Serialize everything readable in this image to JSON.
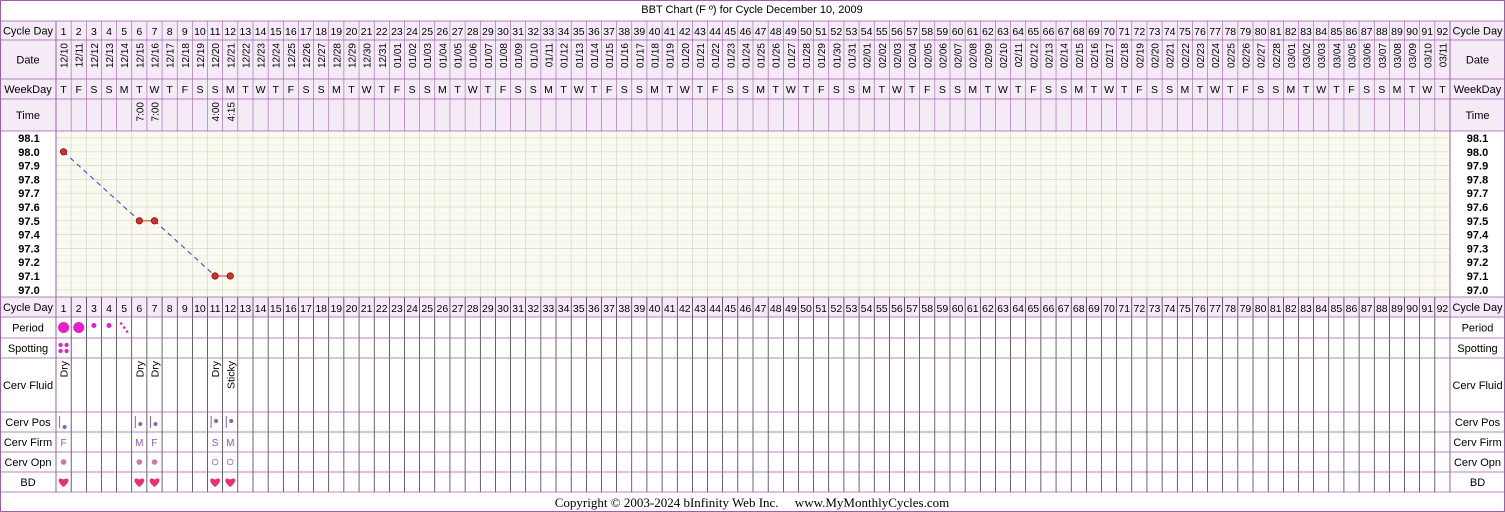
{
  "title": "BBT Chart (F º) for Cycle December 10, 2009",
  "copyright": "Copyright © 2003-2024 bInfinity Web Inc.     www.MyMonthlyCycles.com",
  "labels": {
    "cycle_day": "Cycle Day",
    "date": "Date",
    "weekday": "WeekDay",
    "time": "Time",
    "period": "Period",
    "spotting": "Spotting",
    "cerv_fluid": "Cerv Fluid",
    "cerv_pos": "Cerv Pos",
    "cerv_firm": "Cerv Firm",
    "cerv_opn": "Cerv Opn",
    "bd": "BD"
  },
  "chart_data": {
    "type": "line",
    "title": "BBT Chart (F º) for Cycle December 10, 2009",
    "ylim": [
      97.0,
      98.1
    ],
    "y_ticks": [
      "98.1",
      "98.0",
      "97.9",
      "97.8",
      "97.7",
      "97.6",
      "97.5",
      "97.4",
      "97.3",
      "97.2",
      "97.1",
      "97.0"
    ],
    "grid": true,
    "cycle_days": [
      1,
      2,
      3,
      4,
      5,
      6,
      7,
      8,
      9,
      10,
      11,
      12,
      13,
      14,
      15,
      16,
      17,
      18,
      19,
      20,
      21,
      22,
      23,
      24,
      25,
      26,
      27,
      28,
      29,
      30,
      31,
      32,
      33,
      34,
      35,
      36,
      37,
      38,
      39,
      40,
      41,
      42,
      43,
      44,
      45,
      46,
      47,
      48,
      49,
      50,
      51,
      52,
      53,
      54,
      55,
      56,
      57,
      58,
      59,
      60,
      61,
      62,
      63,
      64,
      65,
      66,
      67,
      68,
      69,
      70,
      71,
      72,
      73,
      74,
      75,
      76,
      77,
      78,
      79,
      80,
      81,
      82,
      83,
      84,
      85,
      86,
      87,
      88,
      89,
      90,
      91,
      92
    ],
    "dates": [
      "12/10",
      "12/11",
      "12/12",
      "12/13",
      "12/14",
      "12/15",
      "12/16",
      "12/17",
      "12/18",
      "12/19",
      "12/20",
      "12/21",
      "12/22",
      "12/23",
      "12/24",
      "12/25",
      "12/26",
      "12/27",
      "12/28",
      "12/29",
      "12/30",
      "12/31",
      "01/01",
      "01/02",
      "01/03",
      "01/04",
      "01/05",
      "01/06",
      "01/07",
      "01/08",
      "01/09",
      "01/10",
      "01/11",
      "01/12",
      "01/13",
      "01/14",
      "01/15",
      "01/16",
      "01/17",
      "01/18",
      "01/19",
      "01/20",
      "01/21",
      "01/22",
      "01/23",
      "01/24",
      "01/25",
      "01/26",
      "01/27",
      "01/28",
      "01/29",
      "01/30",
      "01/31",
      "02/01",
      "02/02",
      "02/03",
      "02/04",
      "02/05",
      "02/06",
      "02/07",
      "02/08",
      "02/09",
      "02/10",
      "02/11",
      "02/12",
      "02/13",
      "02/14",
      "02/15",
      "02/16",
      "02/17",
      "02/18",
      "02/19",
      "02/20",
      "02/21",
      "02/22",
      "02/23",
      "02/24",
      "02/25",
      "02/26",
      "02/27",
      "02/28",
      "03/01",
      "03/02",
      "03/03",
      "03/04",
      "03/05",
      "03/06",
      "03/07",
      "03/08",
      "03/09",
      "03/10",
      "03/11"
    ],
    "weekdays": [
      "T",
      "F",
      "S",
      "S",
      "M",
      "T",
      "W",
      "T",
      "F",
      "S",
      "S",
      "M",
      "T",
      "W",
      "T",
      "F",
      "S",
      "S",
      "M",
      "T",
      "W",
      "T",
      "F",
      "S",
      "S",
      "M",
      "T",
      "W",
      "T",
      "F",
      "S",
      "S",
      "M",
      "T",
      "W",
      "T",
      "F",
      "S",
      "S",
      "M",
      "T",
      "W",
      "T",
      "F",
      "S",
      "S",
      "M",
      "T",
      "W",
      "T",
      "F",
      "S",
      "S",
      "M",
      "T",
      "W",
      "T",
      "F",
      "S",
      "S",
      "M",
      "T",
      "W",
      "T",
      "F",
      "S",
      "S",
      "M",
      "T",
      "W",
      "T",
      "F",
      "S",
      "S",
      "M",
      "T",
      "W",
      "T",
      "F",
      "S",
      "S",
      "M",
      "T",
      "W",
      "T",
      "F",
      "S",
      "S",
      "M",
      "T",
      "W",
      "T"
    ],
    "times": [
      {
        "day": 6,
        "text": "7:00"
      },
      {
        "day": 7,
        "text": "7:00"
      },
      {
        "day": 11,
        "text": "4:00"
      },
      {
        "day": 12,
        "text": "4:15"
      }
    ],
    "temps": [
      {
        "day": 1,
        "temp": 98.0
      },
      {
        "day": 6,
        "temp": 97.5
      },
      {
        "day": 7,
        "temp": 97.5
      },
      {
        "day": 11,
        "temp": 97.1
      },
      {
        "day": 12,
        "temp": 97.1
      }
    ],
    "connections": [
      {
        "from": 1,
        "to": 6,
        "style": "dashed"
      },
      {
        "from": 6,
        "to": 7,
        "style": "solid"
      },
      {
        "from": 7,
        "to": 11,
        "style": "dashed"
      },
      {
        "from": 11,
        "to": 12,
        "style": "solid"
      }
    ],
    "period": [
      {
        "day": 1,
        "level": "heavy"
      },
      {
        "day": 2,
        "level": "heavy"
      },
      {
        "day": 3,
        "level": "light"
      },
      {
        "day": 4,
        "level": "light"
      },
      {
        "day": 5,
        "level": "spotting"
      }
    ],
    "spotting": [
      {
        "day": 1
      }
    ],
    "cerv_fluid": [
      {
        "day": 1,
        "text": "Dry"
      },
      {
        "day": 6,
        "text": "Dry"
      },
      {
        "day": 7,
        "text": "Dry"
      },
      {
        "day": 11,
        "text": "Dry"
      },
      {
        "day": 12,
        "text": "Sticky"
      }
    ],
    "cerv_pos": [
      {
        "day": 1,
        "pos": "low"
      },
      {
        "day": 6,
        "pos": "mid"
      },
      {
        "day": 7,
        "pos": "mid"
      },
      {
        "day": 11,
        "pos": "high"
      },
      {
        "day": 12,
        "pos": "high"
      }
    ],
    "cerv_firm": [
      {
        "day": 1,
        "text": "F"
      },
      {
        "day": 6,
        "text": "M"
      },
      {
        "day": 7,
        "text": "F"
      },
      {
        "day": 11,
        "text": "S"
      },
      {
        "day": 12,
        "text": "M"
      }
    ],
    "cerv_opn": [
      {
        "day": 1,
        "state": "closed"
      },
      {
        "day": 6,
        "state": "closed"
      },
      {
        "day": 7,
        "state": "closed"
      },
      {
        "day": 11,
        "state": "open"
      },
      {
        "day": 12,
        "state": "open"
      }
    ],
    "bd": [
      1,
      6,
      7,
      11,
      12
    ]
  },
  "colors": {
    "border": "#9c5fa8",
    "header_bg": "#f5ebf7",
    "grid_bg": "#fafaf0",
    "grid_line": "#d8d8c8",
    "marker": "#d43030",
    "line": "#3b3bd6",
    "pink": "#e81ec8",
    "heart": "#e8307a",
    "firm_text": "#9a4fc0",
    "pos_dot": "#8a5fb0",
    "opn_closed": "#d07a9a",
    "opn_open": "#d07a9a"
  }
}
